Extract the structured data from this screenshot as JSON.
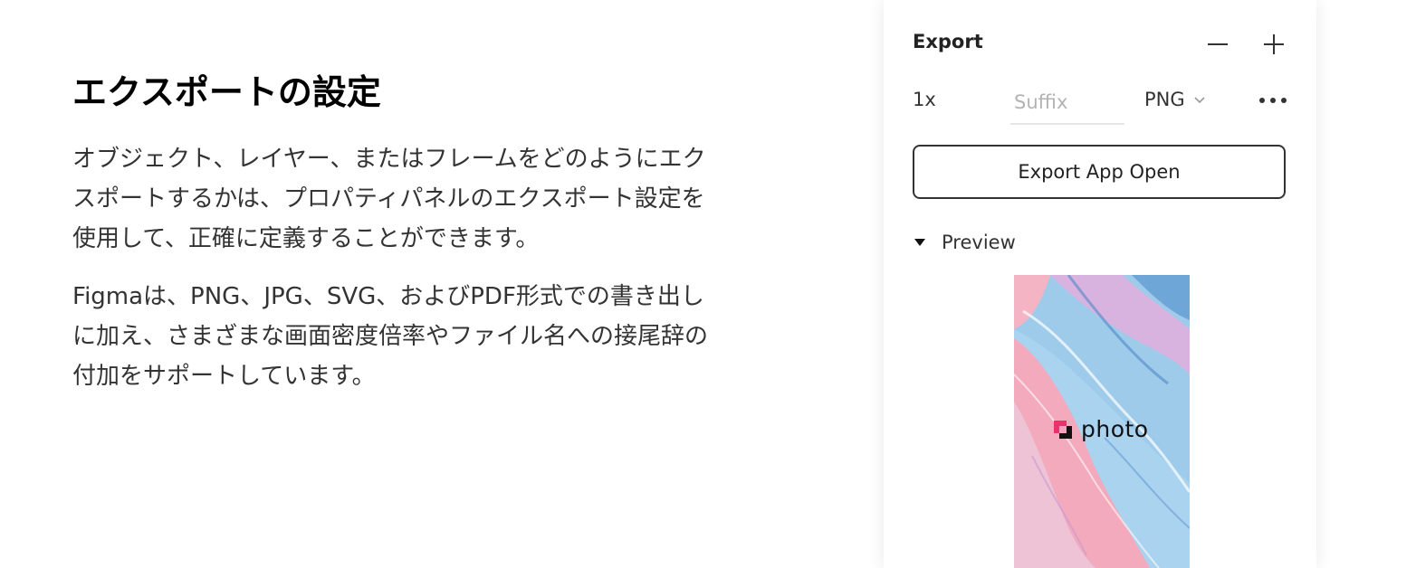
{
  "article": {
    "title": "エクスポートの設定",
    "paragraph1": "オブジェクト、レイヤー、またはフレームをどのようにエクスポートするかは、プロパティパネルのエクスポート設定を使用して、正確に定義することができます。",
    "paragraph2": "Figmaは、PNG、JPG、SVG、およびPDF形式での書き出しに加え、さまざまな画面密度倍率やファイル名への接尾辞の付加をサポートしています。"
  },
  "export_panel": {
    "title": "Export",
    "remove_icon": "minus-icon",
    "add_icon": "plus-icon",
    "scale": "1x",
    "suffix_placeholder": "Suffix",
    "suffix_value": "",
    "format": "PNG",
    "format_icon": "chevron-down-icon",
    "more_icon": "more-dots-icon",
    "export_button_label": "Export App Open",
    "preview_label": "Preview",
    "preview_icon": "triangle-down-icon",
    "preview_logo_text": "photo",
    "colors": {
      "logo_accent": "#e8336d",
      "marble_pink": "#f2a9bb",
      "marble_blue": "#8fc3ea"
    }
  }
}
